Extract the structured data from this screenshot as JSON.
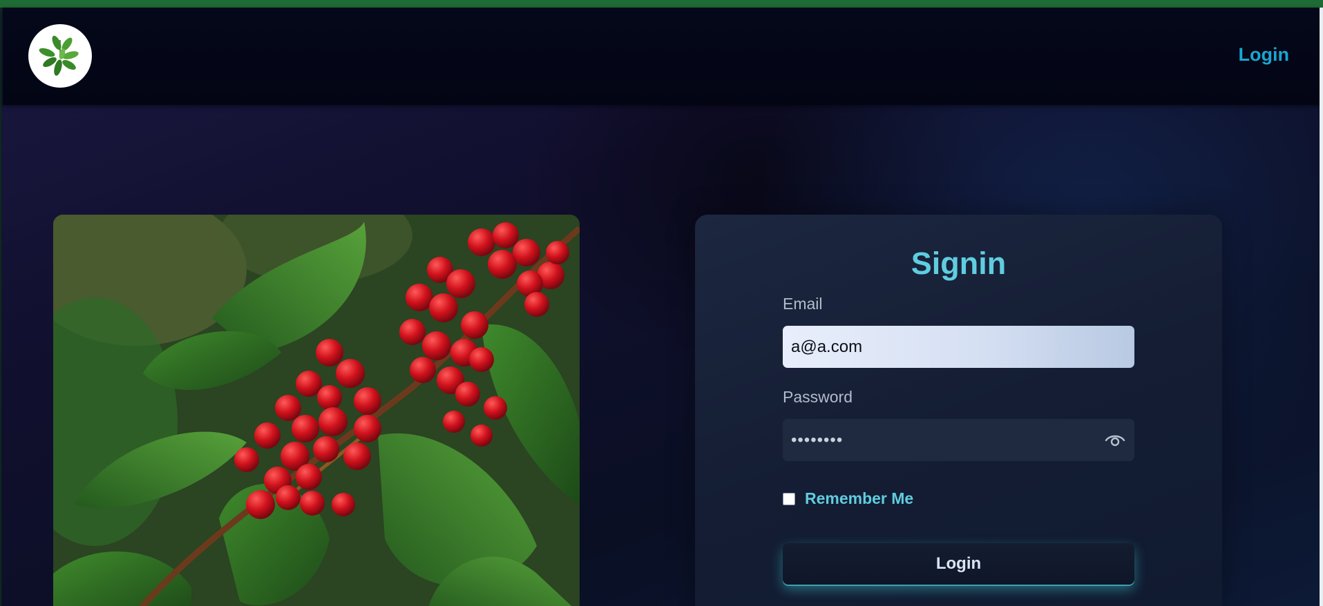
{
  "header": {
    "nav_login_label": "Login"
  },
  "signin": {
    "title": "Signin",
    "email_label": "Email",
    "email_value": "a@a.com",
    "password_label": "Password",
    "password_mask": "••••••••",
    "remember_label": "Remember Me",
    "remember_checked": false,
    "login_button_label": "Login"
  },
  "icons": {
    "logo": "coffee-leaf-logo-icon",
    "show_password": "eye-icon"
  },
  "colors": {
    "top_strip": "#1f6b35",
    "accent": "#5fcde0",
    "nav_link": "#19a6d1",
    "button_glow": "#40d2d7"
  }
}
